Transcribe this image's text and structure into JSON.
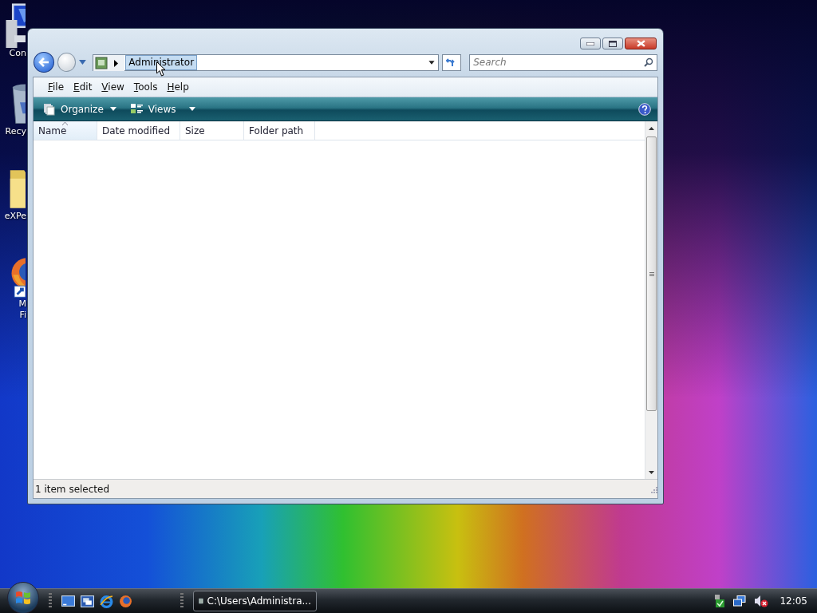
{
  "desktop_icons": [
    {
      "label": [
        "Con"
      ]
    },
    {
      "label": [
        "Recy"
      ]
    },
    {
      "label": [
        "eXPe"
      ]
    },
    {
      "label": [
        "M",
        "Fi"
      ]
    }
  ],
  "window": {
    "address": {
      "crumbs": [
        {
          "label": "Administrator",
          "selected": true
        }
      ]
    },
    "search": {
      "placeholder": "Search"
    },
    "menu": [
      "File",
      "Edit",
      "View",
      "Tools",
      "Help"
    ],
    "toolbar": [
      {
        "label": "Organize"
      },
      {
        "label": "Views"
      }
    ],
    "columns": [
      {
        "label": "Name",
        "sorted": true
      },
      {
        "label": "Date modified",
        "sorted": false
      },
      {
        "label": "Size",
        "sorted": false
      },
      {
        "label": "Folder path",
        "sorted": false
      }
    ],
    "status_bar": "1 item selected"
  },
  "taskbar": {
    "tasks": [
      {
        "label": "C:\\Users\\Administra..."
      }
    ],
    "clock": "12:05"
  }
}
